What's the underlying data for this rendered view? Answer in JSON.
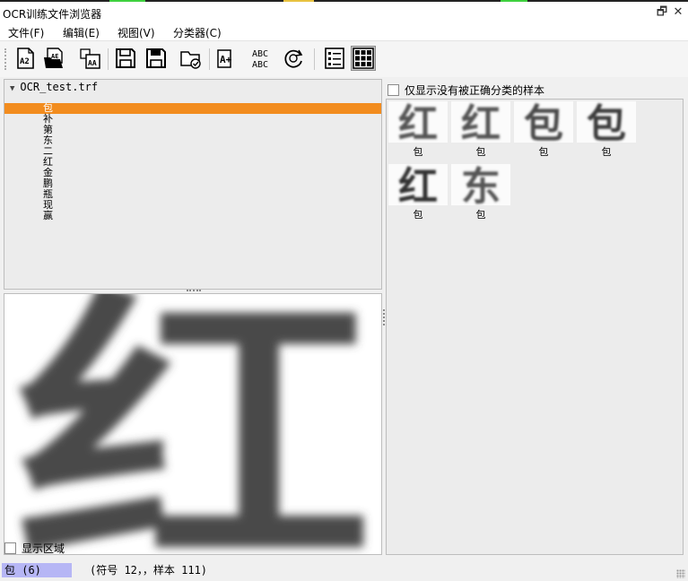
{
  "window": {
    "title": "OCR训练文件浏览器",
    "restore_symbol": "🗗",
    "close_symbol": "✕"
  },
  "menu": [
    {
      "label": "文件(F)"
    },
    {
      "label": "编辑(E)"
    },
    {
      "label": "视图(V)"
    },
    {
      "label": "分类器(C)"
    }
  ],
  "toolbar": {
    "buttons": [
      {
        "icon": "open-file-icon",
        "label": "A2"
      },
      {
        "icon": "open-folder-icon",
        "label": "AE"
      },
      {
        "icon": "open-images-icon",
        "label": "AA"
      },
      {
        "icon": "save-icon"
      },
      {
        "icon": "save-as-icon"
      },
      {
        "icon": "folder-check-icon"
      },
      {
        "icon": "add-sample-icon",
        "label": "A+"
      },
      {
        "icon": "abc-text-icon",
        "label_top": "ABC",
        "label_bottom": "ABC"
      },
      {
        "icon": "refresh-classify-icon"
      },
      {
        "icon": "list-view-icon"
      },
      {
        "icon": "grid-view-icon"
      }
    ]
  },
  "tree": {
    "root": "OCR_test.trf",
    "items": [
      {
        "label": "包",
        "selected": true
      },
      {
        "label": "补"
      },
      {
        "label": "第"
      },
      {
        "label": "东"
      },
      {
        "label": "二"
      },
      {
        "label": "红"
      },
      {
        "label": "金"
      },
      {
        "label": "鹏"
      },
      {
        "label": "瓶"
      },
      {
        "label": "现"
      },
      {
        "label": "赢"
      }
    ]
  },
  "preview": {
    "show_region_label": "显示区域",
    "character": "红"
  },
  "samples": {
    "filter_label": "仅显示没有被正确分类的样本",
    "items": [
      {
        "glyph": "红",
        "label": "包"
      },
      {
        "glyph": "红",
        "label": "包"
      },
      {
        "glyph": "包",
        "label": "包"
      },
      {
        "glyph": "包",
        "label": "包"
      },
      {
        "glyph": "红",
        "label": "包"
      },
      {
        "glyph": "东",
        "label": "包"
      }
    ]
  },
  "status": {
    "selected": "包 (6)",
    "info": "(符号 12，，样本 111)"
  },
  "colors": {
    "selection": "#f28c1e",
    "status_highlight": "#b6b6f5"
  }
}
